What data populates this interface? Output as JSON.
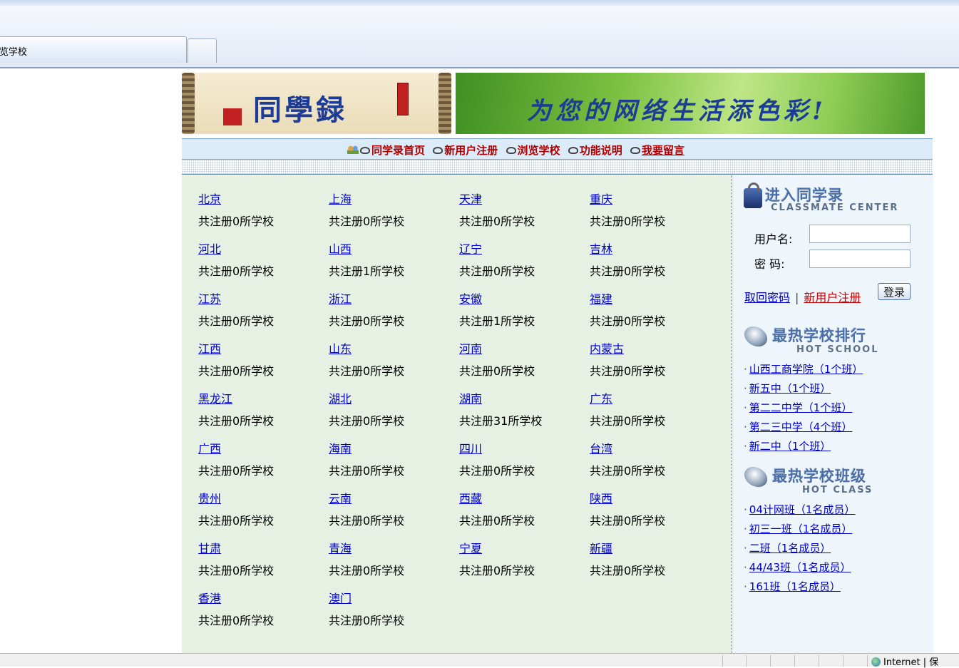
{
  "browser": {
    "tab_title": "览学校",
    "status_zone": "Internet | 保"
  },
  "header": {
    "logo_text": "同學録",
    "slogan": "为您的网络生活添色彩!"
  },
  "nav": {
    "items": [
      "同学录首页",
      "新用户注册",
      "浏览学校",
      "功能说明",
      "我要留言"
    ]
  },
  "provinces": [
    {
      "name": "北京",
      "count": "共注册0所学校"
    },
    {
      "name": "上海",
      "count": "共注册0所学校"
    },
    {
      "name": "天津",
      "count": "共注册0所学校"
    },
    {
      "name": "重庆",
      "count": "共注册0所学校"
    },
    {
      "name": "河北",
      "count": "共注册0所学校"
    },
    {
      "name": "山西",
      "count": "共注册1所学校"
    },
    {
      "name": "辽宁",
      "count": "共注册0所学校"
    },
    {
      "name": "吉林",
      "count": "共注册0所学校"
    },
    {
      "name": "江苏",
      "count": "共注册0所学校"
    },
    {
      "name": "浙江",
      "count": "共注册0所学校"
    },
    {
      "name": "安徽",
      "count": "共注册1所学校"
    },
    {
      "name": "福建",
      "count": "共注册0所学校"
    },
    {
      "name": "江西",
      "count": "共注册0所学校"
    },
    {
      "name": "山东",
      "count": "共注册0所学校"
    },
    {
      "name": "河南",
      "count": "共注册0所学校"
    },
    {
      "name": "内蒙古",
      "count": "共注册0所学校"
    },
    {
      "name": "黑龙江",
      "count": "共注册0所学校"
    },
    {
      "name": "湖北",
      "count": "共注册0所学校"
    },
    {
      "name": "湖南",
      "count": "共注册31所学校"
    },
    {
      "name": "广东",
      "count": "共注册0所学校"
    },
    {
      "name": "广西",
      "count": "共注册0所学校"
    },
    {
      "name": "海南",
      "count": "共注册0所学校"
    },
    {
      "name": "四川",
      "count": "共注册0所学校"
    },
    {
      "name": "台湾",
      "count": "共注册0所学校"
    },
    {
      "name": "贵州",
      "count": "共注册0所学校"
    },
    {
      "name": "云南",
      "count": "共注册0所学校"
    },
    {
      "name": "西藏",
      "count": "共注册0所学校"
    },
    {
      "name": "陕西",
      "count": "共注册0所学校"
    },
    {
      "name": "甘肃",
      "count": "共注册0所学校"
    },
    {
      "name": "青海",
      "count": "共注册0所学校"
    },
    {
      "name": "宁夏",
      "count": "共注册0所学校"
    },
    {
      "name": "新疆",
      "count": "共注册0所学校"
    },
    {
      "name": "香港",
      "count": "共注册0所学校"
    },
    {
      "name": "澳门",
      "count": "共注册0所学校"
    }
  ],
  "login": {
    "title": "进入同学录",
    "subtitle": "CLASSMATE CENTER",
    "username_label": "用户名:",
    "password_label": "密  码:",
    "forgot_link": "取回密码",
    "separator": "|",
    "register_link": "新用户注册",
    "login_button": "登录"
  },
  "hot_school": {
    "title": "最热学校排行",
    "subtitle": "HOT SCHOOL",
    "items": [
      "山西工商学院（1个班）",
      "新五中（1个班）",
      "第二二中学（1个班）",
      "第二三中学（4个班）",
      "新二中（1个班）"
    ]
  },
  "hot_class": {
    "title": "最热学校班级",
    "subtitle": "HOT CLASS",
    "items": [
      "04计网班（1名成员）",
      "初三一班（1名成员）",
      "二班（1名成员）",
      "44/43班（1名成员）",
      "161班（1名成员）"
    ]
  }
}
